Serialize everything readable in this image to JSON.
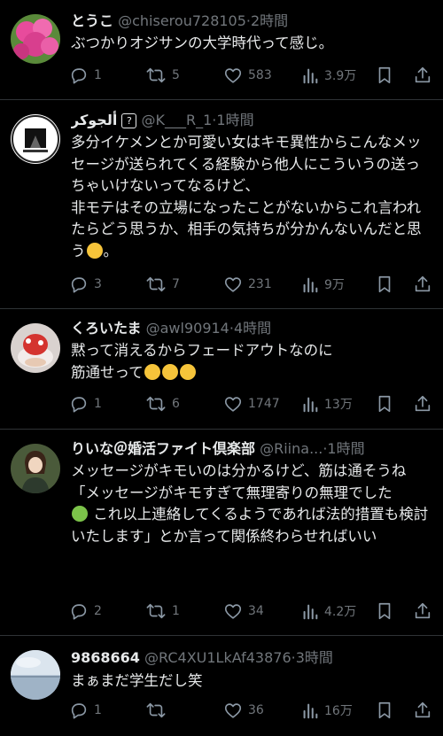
{
  "tweets": [
    {
      "name": "とうこ",
      "handle": "@chiserou728105",
      "time": "2時間",
      "body": "ぶつかりオジサンの大学時代って感じ。",
      "replies": "1",
      "retweets": "5",
      "likes": "583",
      "views": "3.9万"
    },
    {
      "name": "ألجوكر",
      "handle": "@K___R_1",
      "time": "1時間",
      "body": "多分イケメンとか可愛い女はキモ異性からこんなメッセージが送られてくる経験から他人にこういうの送っちゃいけないってなるけど、\n非モテはその立場になったことがないからこれ言われたらどう思うか、相手の気持ちが分かんないんだと思う",
      "body_end": "。",
      "replies": "3",
      "retweets": "7",
      "likes": "231",
      "views": "9万"
    },
    {
      "name": "くろいたま",
      "handle": "@awl90914",
      "time": "4時間",
      "body": "黙って消えるからフェードアウトなのに\n筋通せって",
      "replies": "1",
      "retweets": "6",
      "likes": "1747",
      "views": "13万"
    },
    {
      "name": "りいな＠婚活ファイト倶楽部",
      "handle": "@Riina...",
      "time": "1時間",
      "body_line1": "メッセージがキモいのは分かるけど、筋は通そうね\n「メッセージがキモすぎて無理寄りの無理でした",
      "body_line2": "これ以上連絡してくるようであれば法的措置も検討いたします」とか言って関係終わらせればいい",
      "replies": "2",
      "retweets": "1",
      "likes": "34",
      "views": "4.2万"
    },
    {
      "name": "9868664",
      "handle": "@RC4XU1LkAf43876",
      "time": "3時間",
      "body": "まぁまだ学生だし笑",
      "replies": "1",
      "retweets": "",
      "likes": "36",
      "views": "16万"
    }
  ],
  "separator": "·",
  "colors": {
    "background": "#000000",
    "text": "#e7e9ea",
    "muted": "#71767b",
    "divider": "#2f3336"
  },
  "icons": [
    "reply-icon",
    "retweet-icon",
    "like-icon",
    "views-icon",
    "bookmark-icon",
    "share-icon"
  ]
}
